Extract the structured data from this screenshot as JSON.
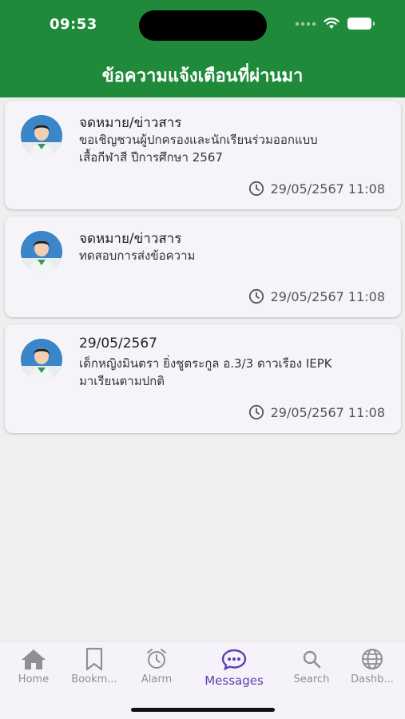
{
  "status_bar": {
    "time": "09:53"
  },
  "header": {
    "title": "ข้อความแจ้งเตือนที่ผ่านมา"
  },
  "colors": {
    "header_bg": "#1e8a3a",
    "active_tab": "#5b3fb0",
    "inactive_tab": "#8f8f94"
  },
  "notifications": [
    {
      "title": "จดหมาย/ข่าวสาร",
      "body_line1": "ขอเชิญชวนผู้ปกครองและนักเรียนร่วมออกแบบ",
      "body_line2": "เสื้อกีฬาสี ปีการศึกษา 2567",
      "timestamp": "29/05/2567 11:08"
    },
    {
      "title": "จดหมาย/ข่าวสาร",
      "body_line1": "ทดสอบการส่งข้อความ",
      "body_line2": "",
      "timestamp": "29/05/2567 11:08"
    },
    {
      "title": "29/05/2567",
      "body_line1": "เด็กหญิงมินตรา ยิ่งชูตระกูล อ.3/3 ดาวเรือง IEPK",
      "body_line2": "มาเรียนตามปกติ",
      "timestamp": "29/05/2567 11:08"
    }
  ],
  "tabs": [
    {
      "label": "Home",
      "icon": "home-icon"
    },
    {
      "label": "Bookm...",
      "icon": "bookmark-icon"
    },
    {
      "label": "Alarm",
      "icon": "alarm-icon"
    },
    {
      "label": "Messages",
      "icon": "messages-icon",
      "active": true
    },
    {
      "label": "Search",
      "icon": "search-icon"
    },
    {
      "label": "Dashb...",
      "icon": "globe-icon"
    }
  ]
}
